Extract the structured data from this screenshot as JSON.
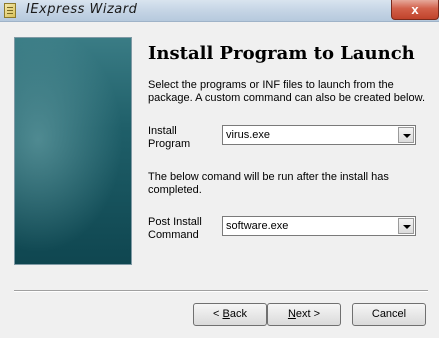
{
  "window": {
    "title": "IExpress Wizard",
    "close_glyph": "x"
  },
  "page": {
    "heading": "Install Program to Launch",
    "description": "Select the programs or INF files to launch from the package.  A custom command can also be created below."
  },
  "install_program": {
    "label_line1": "Install",
    "label_line2": "Program",
    "value": "virus.exe"
  },
  "note": "The below comand will be run after the install has completed.",
  "post_install": {
    "label_line1": "Post Install",
    "label_line2": "Command",
    "value": "software.exe"
  },
  "buttons": {
    "back_prefix": "< ",
    "back_access": "B",
    "back_rest": "ack",
    "next_access": "N",
    "next_rest": "ext >",
    "cancel": "Cancel"
  },
  "icons": {
    "app": "iexpress-app-icon",
    "close": "close-icon",
    "dropdown": "chevron-down-icon"
  }
}
